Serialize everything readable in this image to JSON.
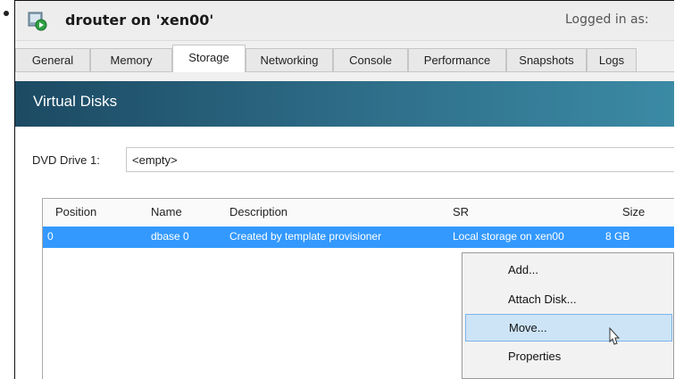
{
  "window": {
    "title": "drouter on 'xen00'",
    "logged_in": "Logged in as:"
  },
  "tabs": [
    {
      "label": "General"
    },
    {
      "label": "Memory"
    },
    {
      "label": "Storage",
      "active": true
    },
    {
      "label": "Networking"
    },
    {
      "label": "Console"
    },
    {
      "label": "Performance"
    },
    {
      "label": "Snapshots"
    },
    {
      "label": "Logs"
    }
  ],
  "section": {
    "title": "Virtual Disks"
  },
  "dvd": {
    "label": "DVD Drive 1:",
    "value": "<empty>"
  },
  "disks_table": {
    "columns": [
      "Position",
      "Name",
      "Description",
      "SR",
      "Size"
    ],
    "rows": [
      {
        "position": "0",
        "name": "dbase 0",
        "description": "Created by template provisioner",
        "sr": "Local storage on xen00",
        "size": "8 GB",
        "selected": true
      }
    ]
  },
  "context_menu": {
    "items": [
      {
        "label": "Add..."
      },
      {
        "label": "Attach Disk..."
      },
      {
        "label": "Move...",
        "highlighted": true
      },
      {
        "label": "Properties"
      }
    ]
  },
  "colors": {
    "selection": "#3399ff",
    "banner": "#2f6f8a",
    "menu_highlight": "#cde4f7"
  },
  "icons": {
    "vm": "vm-running-icon",
    "cursor": "mouse-pointer-icon"
  }
}
